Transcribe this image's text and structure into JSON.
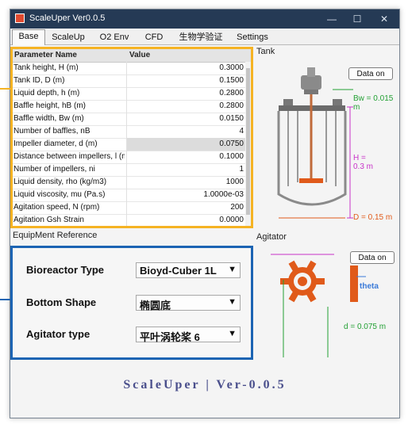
{
  "window": {
    "title": "ScaleUper   Ver0.0.5",
    "controls": {
      "minimize": "—",
      "maximize": "☐",
      "close": "✕"
    }
  },
  "tabs": [
    "Base",
    "ScaleUp",
    "O2 Env",
    "CFD",
    "生物学验证",
    "Settings"
  ],
  "active_tab": "Base",
  "table": {
    "headers": [
      "Parameter Name",
      "Value"
    ],
    "rows": [
      {
        "name": "Tank height, H (m)",
        "value": "0.3000"
      },
      {
        "name": "Tank ID, D (m)",
        "value": "0.1500"
      },
      {
        "name": "Liquid depth, h (m)",
        "value": "0.2800"
      },
      {
        "name": "Baffle height, hB (m)",
        "value": "0.2800"
      },
      {
        "name": "Baffle width, Bw (m)",
        "value": "0.0150"
      },
      {
        "name": "Number of baffles, nB",
        "value": "4"
      },
      {
        "name": "Impeller diameter, d (m)",
        "value": "0.0750"
      },
      {
        "name": "Distance between impellers, l (m)",
        "value": "0.1000"
      },
      {
        "name": "Number of impellers, ni",
        "value": "1"
      },
      {
        "name": "Liquid density, rho (kg/m3)",
        "value": "1000"
      },
      {
        "name": "Liquid viscosity, mu (Pa.s)",
        "value": "1.0000e-03"
      },
      {
        "name": "Agitation speed, N (rpm)",
        "value": "200"
      },
      {
        "name": "Agitation Gsh Strain",
        "value": "0.0000"
      }
    ]
  },
  "tank": {
    "label": "Tank",
    "data_button": "Data on",
    "bw_label": "Bw = 0.015 m",
    "h_label_1": "H =",
    "h_label_2": "0.3 m",
    "d_label": "D = 0.15 m"
  },
  "agitator": {
    "label": "Agitator",
    "data_button": "Data on",
    "theta_label": "theta",
    "d_label": "d = 0.075 m"
  },
  "equipment": {
    "label": "EquipMent Reference",
    "bioreactor_label": "Bioreactor Type",
    "bioreactor_value": "Bioyd-Cuber 1L",
    "bottom_label": "Bottom Shape",
    "bottom_value": "椭圆底",
    "agitator_label": "Agitator type",
    "agitator_value": "平叶涡轮桨 6"
  },
  "footer": "ScaleUper  |  Ver-0.0.5",
  "colors": {
    "titlebar": "#253a55",
    "highlight_yellow": "#f5b323",
    "highlight_blue": "#1c64b3",
    "footer_text": "#4a4f8c",
    "dimension_magenta": "#c832c8",
    "dimension_green": "#22a033",
    "dimension_orange": "#e05a1a",
    "dimension_blue": "#3a7ad8"
  }
}
